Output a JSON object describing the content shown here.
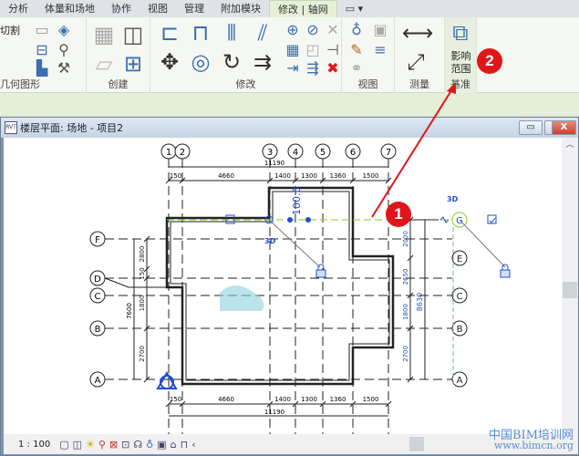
{
  "tabs": [
    {
      "label": "分析"
    },
    {
      "label": "体量和场地"
    },
    {
      "label": "协作"
    },
    {
      "label": "视图"
    },
    {
      "label": "管理"
    },
    {
      "label": "附加模块"
    },
    {
      "label": "修改 | 轴网",
      "active": true
    },
    {
      "label": "▭ ▾"
    }
  ],
  "ribbon": {
    "cut_label": "切割",
    "panels": {
      "geometry": "几何图形",
      "create": "创建",
      "modify": "修改",
      "view": "视图",
      "measure": "测量",
      "datum": "基准"
    },
    "scope_box": {
      "line1": "影响",
      "line2": "范围"
    }
  },
  "window": {
    "title": "楼层平面: 场地 - 项目2",
    "minimize": "▭",
    "maximize": "▢",
    "close": "X",
    "rvt": "RVT"
  },
  "drawing": {
    "vertical_grids": [
      "1",
      "2",
      "3",
      "4",
      "5",
      "6",
      "7"
    ],
    "left_grids": [
      "F",
      "D",
      "C",
      "B",
      "A"
    ],
    "right_grids": [
      "G",
      "E",
      "C",
      "B",
      "A"
    ],
    "top_total": "11190",
    "top_segments": [
      "150",
      "4660",
      "1400",
      "1300",
      "1360",
      "1500"
    ],
    "bottom_total": "11190",
    "bottom_segments": [
      "150",
      "4660",
      "1400",
      "1300",
      "1360",
      "1500"
    ],
    "left_segments": [
      "2800",
      "150",
      "1800",
      "2700"
    ],
    "left_total": "7600",
    "right_segments": [
      "2000",
      "2650",
      "1800",
      "2700"
    ],
    "right_total": "8630",
    "temp_dim": "100.0",
    "label_3d": "3D",
    "accent_blue": "#1f4fcf",
    "selection_green": "#7ed321"
  },
  "status": {
    "scale": "1 : 100"
  },
  "badges": [
    "1",
    "2"
  ],
  "watermark": {
    "line1": "中国BIM培训网",
    "line2": "www.bimcn.org"
  }
}
